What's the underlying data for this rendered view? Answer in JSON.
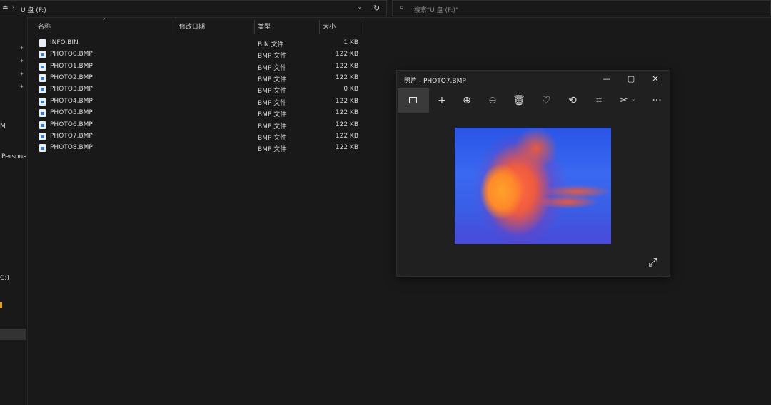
{
  "explorer": {
    "address_path": "U 盘 (F:)",
    "search_placeholder": "搜索\"U 盘 (F:)\"",
    "sidebar_labels": [
      "M",
      "Persona",
      "C:)"
    ],
    "columns": {
      "name": "名称",
      "date": "修改日期",
      "type": "类型",
      "size": "大小"
    },
    "files": [
      {
        "name": "INFO.BIN",
        "type": "BIN 文件",
        "size": "1 KB",
        "icon": "file-icon"
      },
      {
        "name": "PHOTO0.BMP",
        "type": "BMP 文件",
        "size": "122 KB",
        "icon": "image-file-icon"
      },
      {
        "name": "PHOTO1.BMP",
        "type": "BMP 文件",
        "size": "122 KB",
        "icon": "image-file-icon"
      },
      {
        "name": "PHOTO2.BMP",
        "type": "BMP 文件",
        "size": "122 KB",
        "icon": "image-file-icon"
      },
      {
        "name": "PHOTO3.BMP",
        "type": "BMP 文件",
        "size": "0 KB",
        "icon": "image-file-icon"
      },
      {
        "name": "PHOTO4.BMP",
        "type": "BMP 文件",
        "size": "122 KB",
        "icon": "image-file-icon"
      },
      {
        "name": "PHOTO5.BMP",
        "type": "BMP 文件",
        "size": "122 KB",
        "icon": "image-file-icon"
      },
      {
        "name": "PHOTO6.BMP",
        "type": "BMP 文件",
        "size": "122 KB",
        "icon": "image-file-icon"
      },
      {
        "name": "PHOTO7.BMP",
        "type": "BMP 文件",
        "size": "122 KB",
        "icon": "image-file-icon"
      },
      {
        "name": "PHOTO8.BMP",
        "type": "BMP 文件",
        "size": "122 KB",
        "icon": "image-file-icon"
      }
    ]
  },
  "photos": {
    "title": "照片 - PHOTO7.BMP",
    "toolbar": [
      "view-image-icon",
      "add-icon",
      "zoom-in-icon",
      "zoom-out-icon",
      "delete-icon",
      "heart-icon",
      "rotate-icon",
      "crop-icon",
      "edit-icon",
      "more-icon"
    ]
  },
  "colors": {
    "background": "#191919",
    "window": "#202020",
    "accent_active": "#3a3a3a"
  }
}
